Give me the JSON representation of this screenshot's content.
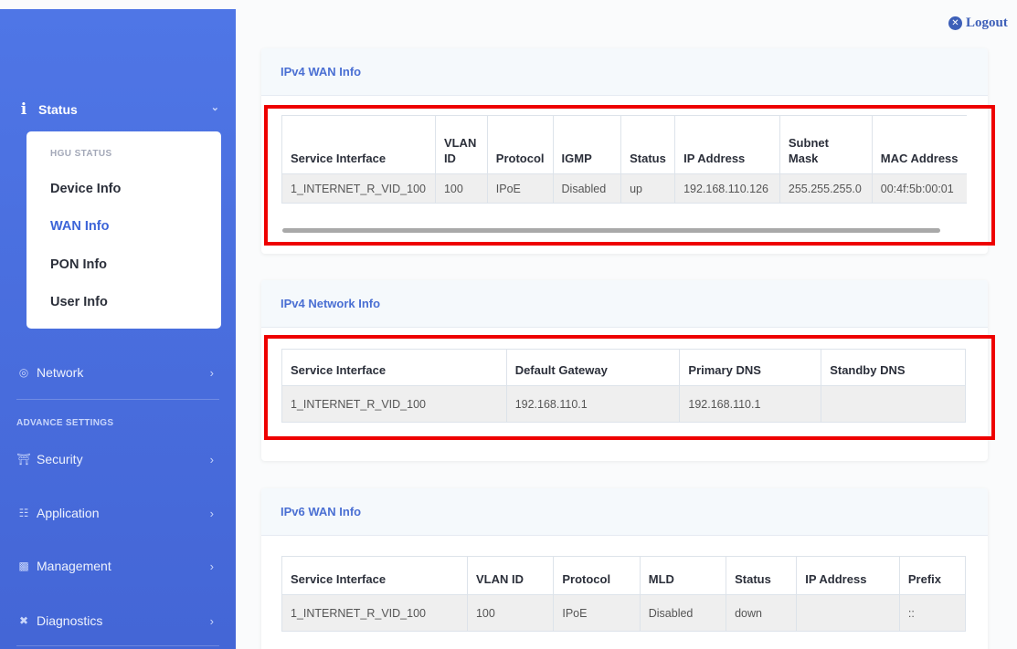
{
  "header": {
    "logout_label": "Logout"
  },
  "sidebar": {
    "status_label": "Status",
    "hgu_status_title": "HGU STATUS",
    "status_items": [
      "Device Info",
      "WAN Info",
      "PON Info",
      "User Info"
    ],
    "active_item": "WAN Info",
    "network_label": "Network",
    "advance_settings_title": "ADVANCE SETTINGS",
    "security_label": "Security",
    "application_label": "Application",
    "management_label": "Management",
    "diagnostics_label": "Diagnostics"
  },
  "ipv4_wan": {
    "title": "IPv4 WAN Info",
    "headers": [
      "Service Interface",
      "VLAN ID",
      "Protocol",
      "IGMP",
      "Status",
      "IP Address",
      "Subnet Mask",
      "MAC Address"
    ],
    "row": [
      "1_INTERNET_R_VID_100",
      "100",
      "IPoE",
      "Disabled",
      "up",
      "192.168.110.126",
      "255.255.255.0",
      "00:4f:5b:00:01"
    ]
  },
  "ipv4_network": {
    "title": "IPv4 Network Info",
    "headers": [
      "Service Interface",
      "Default Gateway",
      "Primary DNS",
      "Standby DNS"
    ],
    "row": [
      "1_INTERNET_R_VID_100",
      "192.168.110.1",
      "192.168.110.1",
      ""
    ]
  },
  "ipv6_wan": {
    "title": "IPv6 WAN Info",
    "headers": [
      "Service Interface",
      "VLAN ID",
      "Protocol",
      "MLD",
      "Status",
      "IP Address",
      "Prefix"
    ],
    "row": [
      "1_INTERNET_R_VID_100",
      "100",
      "IPoE",
      "Disabled",
      "down",
      "",
      "::"
    ]
  },
  "colors": {
    "sidebar_bg": "#4a6fdf",
    "accent": "#3c64d8",
    "highlight_box": "#ee0000"
  }
}
